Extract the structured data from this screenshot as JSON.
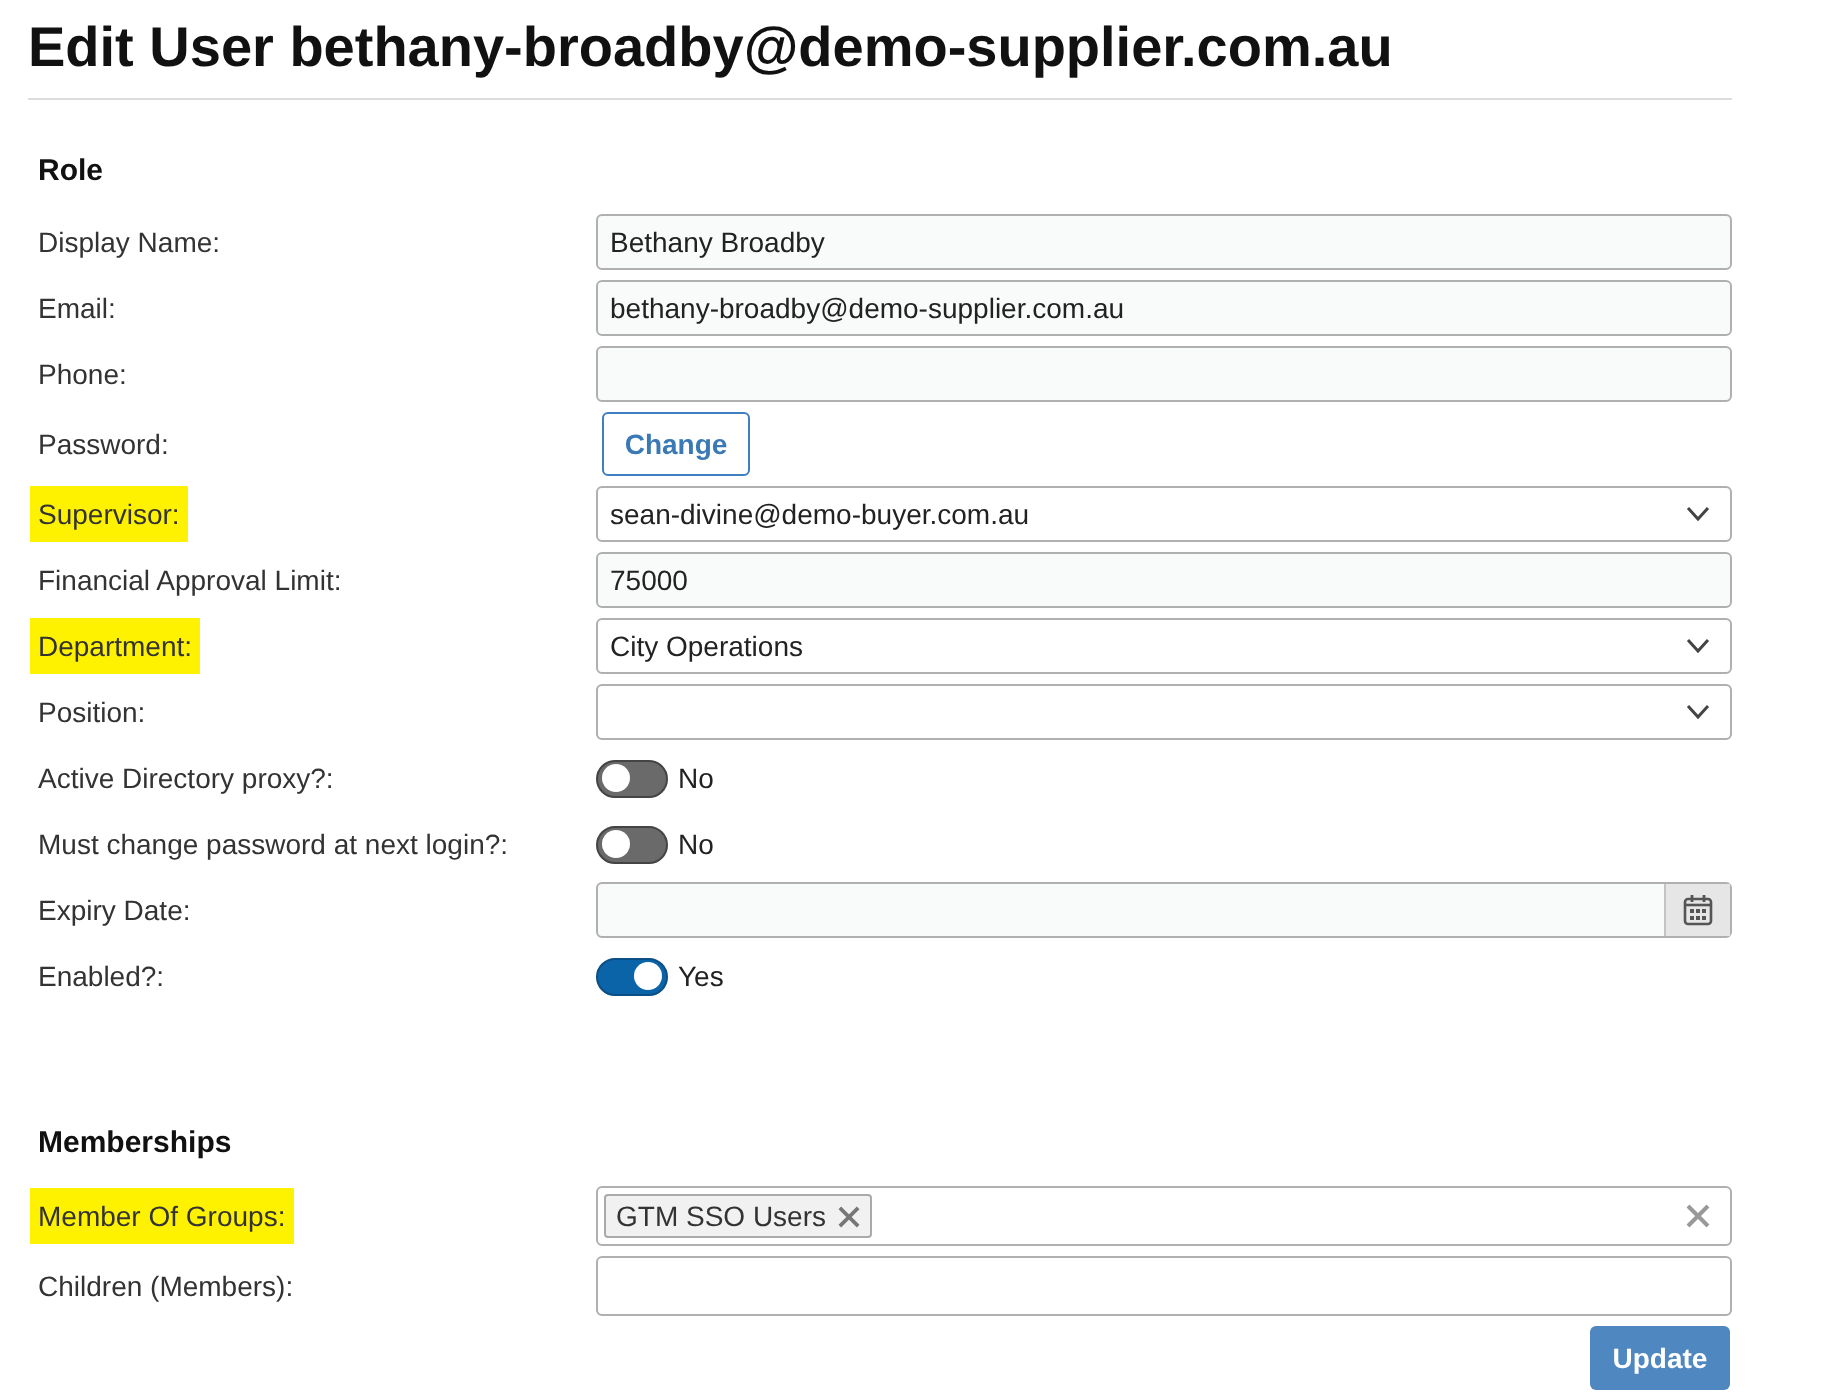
{
  "title": "Edit User bethany-broadby@demo-supplier.com.au",
  "sections": [
    {
      "heading": "Role",
      "rows": [
        {
          "label": "Display Name:",
          "highlighted": false,
          "kind": "text",
          "value": "Bethany Broadby"
        },
        {
          "label": "Email:",
          "highlighted": false,
          "kind": "text",
          "value": "bethany-broadby@demo-supplier.com.au"
        },
        {
          "label": "Phone:",
          "highlighted": false,
          "kind": "text"
        },
        {
          "label": "Password:",
          "highlighted": false,
          "kind": "button",
          "button": "Change"
        },
        {
          "label": "Supervisor:",
          "highlighted": true,
          "kind": "select",
          "value": "sean-divine@demo-buyer.com.au"
        },
        {
          "label": "Financial Approval Limit:",
          "highlighted": false,
          "kind": "text",
          "value": "75000"
        },
        {
          "label": "Department:",
          "highlighted": true,
          "kind": "select",
          "value": "City Operations"
        },
        {
          "label": "Position:",
          "highlighted": false,
          "kind": "select"
        },
        {
          "label": "Active Directory proxy?:",
          "highlighted": false,
          "kind": "toggle",
          "on": false,
          "value": "No"
        },
        {
          "label": "Must change password at next login?:",
          "highlighted": false,
          "kind": "toggle",
          "on": false,
          "value": "No"
        },
        {
          "label": "Expiry Date:",
          "highlighted": false,
          "kind": "date"
        },
        {
          "label": "Enabled?:",
          "highlighted": false,
          "kind": "toggle",
          "on": true,
          "value": "Yes"
        }
      ]
    },
    {
      "heading": "Memberships",
      "rows": [
        {
          "label": "Member Of Groups:",
          "highlighted": true,
          "kind": "tags",
          "tags": [
            {
              "label": "GTM SSO Users"
            }
          ]
        },
        {
          "label": "Children (Members):",
          "highlighted": false,
          "kind": "tags"
        }
      ]
    }
  ],
  "update_button": "Update"
}
